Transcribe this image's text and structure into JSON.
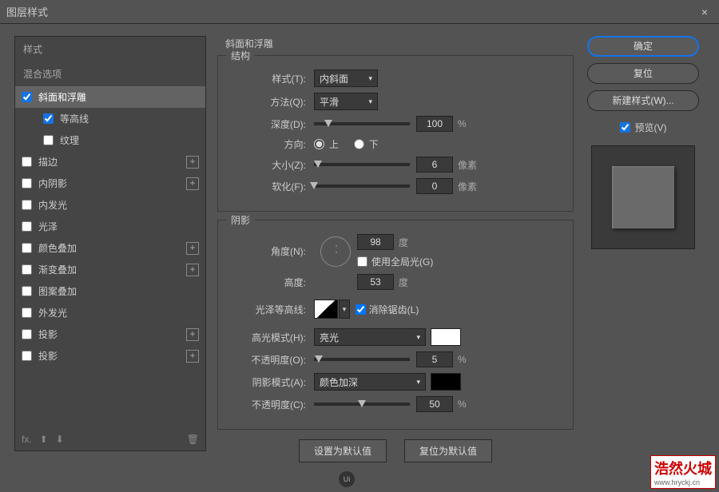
{
  "window": {
    "title": "图层样式",
    "close": "×"
  },
  "left": {
    "styles_label": "样式",
    "blend_label": "混合选项",
    "items": [
      {
        "label": "斜面和浮雕",
        "checked": true,
        "selected": true,
        "plus": false
      },
      {
        "label": "等高线",
        "checked": true,
        "indented": true,
        "plus": false
      },
      {
        "label": "纹理",
        "checked": false,
        "indented": true,
        "plus": false
      },
      {
        "label": "描边",
        "checked": false,
        "plus": true
      },
      {
        "label": "内阴影",
        "checked": false,
        "plus": true
      },
      {
        "label": "内发光",
        "checked": false,
        "plus": false
      },
      {
        "label": "光泽",
        "checked": false,
        "plus": false
      },
      {
        "label": "颜色叠加",
        "checked": false,
        "plus": true
      },
      {
        "label": "渐变叠加",
        "checked": false,
        "plus": true
      },
      {
        "label": "图案叠加",
        "checked": false,
        "plus": false
      },
      {
        "label": "外发光",
        "checked": false,
        "plus": false
      },
      {
        "label": "投影",
        "checked": false,
        "plus": true
      },
      {
        "label": "投影",
        "checked": false,
        "plus": true
      }
    ],
    "footer": {
      "fx": "fx.",
      "up": "⬆",
      "down": "⬇",
      "trash": "🗑"
    }
  },
  "center": {
    "title": "斜面和浮雕",
    "structure": {
      "legend": "结构",
      "style_label": "样式(T):",
      "style_value": "内斜面",
      "technique_label": "方法(Q):",
      "technique_value": "平滑",
      "depth_label": "深度(D):",
      "depth_value": "100",
      "depth_unit": "%",
      "direction_label": "方向:",
      "up_label": "上",
      "down_label": "下",
      "size_label": "大小(Z):",
      "size_value": "6",
      "size_unit": "像素",
      "soften_label": "软化(F):",
      "soften_value": "0",
      "soften_unit": "像素"
    },
    "shading": {
      "legend": "阴影",
      "angle_label": "角度(N):",
      "angle_value": "98",
      "angle_unit": "度",
      "global_label": "使用全局光(G)",
      "altitude_label": "高度:",
      "altitude_value": "53",
      "altitude_unit": "度",
      "gloss_label": "光泽等高线:",
      "antialias_label": "消除锯齿(L)",
      "highlight_mode_label": "高光模式(H):",
      "highlight_mode_value": "亮光",
      "highlight_opacity_label": "不透明度(O):",
      "highlight_opacity_value": "5",
      "highlight_opacity_unit": "%",
      "shadow_mode_label": "阴影模式(A):",
      "shadow_mode_value": "颜色加深",
      "shadow_opacity_label": "不透明度(C):",
      "shadow_opacity_value": "50",
      "shadow_opacity_unit": "%",
      "highlight_color": "#ffffff",
      "shadow_color": "#000000"
    },
    "buttons": {
      "set_default": "设置为默认值",
      "reset_default": "复位为默认值"
    }
  },
  "right": {
    "ok": "确定",
    "cancel": "复位",
    "new_style": "新建样式(W)...",
    "preview_label": "预览(V)"
  },
  "watermark": {
    "cn": "浩然火城",
    "url": "www.hryckj.cn"
  },
  "logo": "Ui"
}
